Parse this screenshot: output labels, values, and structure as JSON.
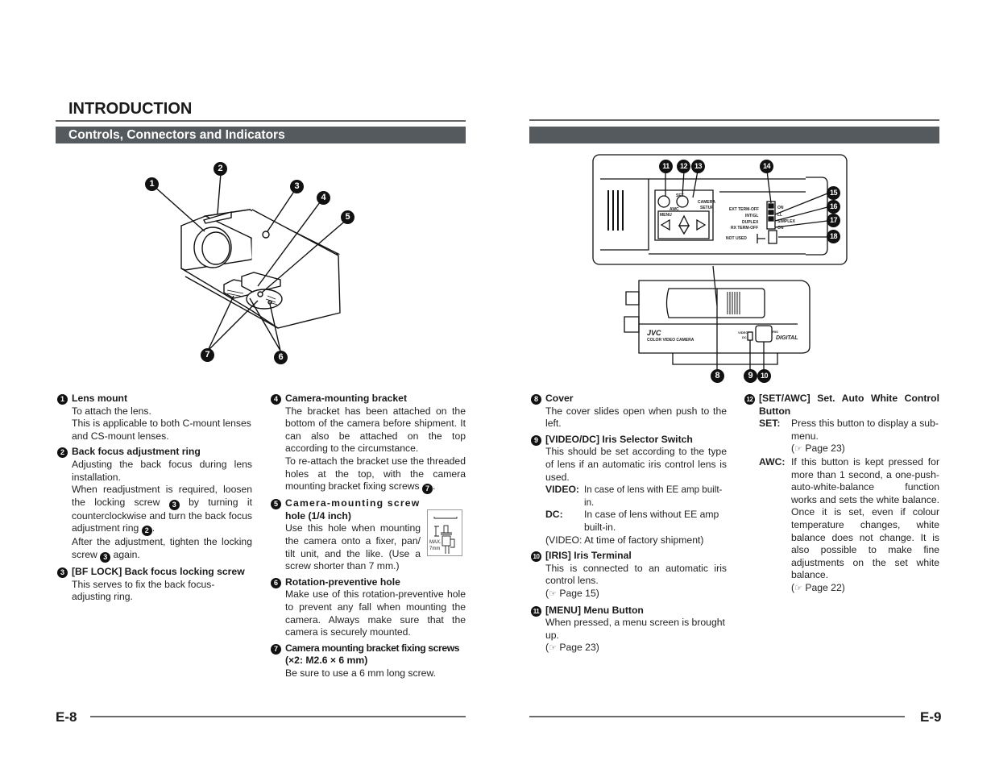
{
  "left_page": {
    "title": "INTRODUCTION",
    "section_title": "Controls, Connectors and Indicators",
    "page_number": "E-8",
    "figure_callouts": [
      "1",
      "2",
      "3",
      "4",
      "5",
      "6",
      "7"
    ],
    "items": [
      {
        "num": "1",
        "heading": "Lens mount",
        "lines": [
          "To attach the lens.",
          "This is applicable to both C-mount lenses and CS-mount lenses."
        ]
      },
      {
        "num": "2",
        "heading": "Back focus adjustment ring",
        "p1": "Adjusting the back focus during lens installation.",
        "p2a": "When readjustment is required, loosen the locking screw",
        "p2_ref1": "3",
        "p2b": "by turning it counterclockwise and turn the back focus adjustment ring",
        "p2_ref2": "2",
        "p2c": ".",
        "p3a": "After the adjustment, tighten the locking screw",
        "p3_ref": "3",
        "p3b": "again."
      },
      {
        "num": "3",
        "heading": "[BF LOCK] Back focus locking screw",
        "text": "This serves to fix the back focus-adjusting ring."
      },
      {
        "num": "4",
        "heading": "Camera-mounting bracket",
        "p1": "The bracket has been attached on the bottom of the camera before shipment. It can also be attached on the top according to the circumstance.",
        "p2": "To re-attach the bracket use the threaded holes at the top, with the camera mounting bracket fixing screws",
        "p2_ref": "7",
        "p2_end": "."
      },
      {
        "num": "5",
        "heading_a": "Camera-mounting screw",
        "heading_b": "hole (1/4 inch)",
        "text": "Use this hole when mounting the camera onto a fixer, pan/ tilt unit, and the like. (Use a screw shorter than 7 mm.)",
        "inset_label_1": "MAX.",
        "inset_label_2": "7mm"
      },
      {
        "num": "6",
        "heading": "Rotation-preventive hole",
        "text": "Make use of this rotation-preventive hole to prevent any fall when mounting the camera.  Always make sure that the camera is securely mounted."
      },
      {
        "num": "7",
        "heading_a": "Camera mounting bracket fixing screws",
        "heading_b": "(×2: M2.6 × 6 mm)",
        "text": "Be sure to use a 6 mm long screw."
      }
    ]
  },
  "right_page": {
    "section_title": "",
    "page_number": "E-9",
    "figure": {
      "top_callouts": [
        "11",
        "12",
        "13",
        "14"
      ],
      "side_callouts": [
        "15",
        "16",
        "17",
        "18"
      ],
      "bottom_callouts": [
        "8",
        "9",
        "10"
      ],
      "labels": {
        "set": "SET",
        "awc": "AWC",
        "menu": "MENU",
        "camera": "CAMERA",
        "setup": "SETUP",
        "ext_term": "EXT TERM-OFF",
        "intgl": "INT/GL",
        "duplex": "DUPLEX",
        "rx_term": "RX TERM-OFF",
        "not_used": "NOT USED",
        "on1": "ON",
        "ll": "LL",
        "simplex": "SIMPLEX",
        "on2": "ON",
        "brand": "JVC",
        "model": "COLOR  VIDEO  CAMERA",
        "digital": "DIGITAL",
        "video": "VIDEO",
        "dc": "DC",
        "iris": "IRIS"
      }
    },
    "items": [
      {
        "num": "8",
        "heading": "Cover",
        "text": "The cover slides open when push to the left."
      },
      {
        "num": "9",
        "heading": "[VIDEO/DC] Iris Selector Switch",
        "text": "This should be set according to the type of lens if an automatic iris control lens is used.",
        "defs": [
          {
            "k": "VIDEO:",
            "v": "In case of lens with EE amp built-in."
          },
          {
            "k": "DC:",
            "v": "In case of lens without EE amp built-in."
          }
        ],
        "note": "(VIDEO: At time of factory shipment)"
      },
      {
        "num": "10",
        "heading": "[IRIS] Iris Terminal",
        "text": "This is connected to an automatic iris control lens.",
        "ref": "Page 15"
      },
      {
        "num": "11",
        "heading": "[MENU] Menu Button",
        "text": "When pressed, a menu screen is brought up.",
        "ref": "Page 23"
      },
      {
        "num": "12",
        "heading": "[SET/AWC] Set. Auto White Control Button",
        "defs": [
          {
            "k": "SET:",
            "v": "Press this button to display a sub-menu.",
            "ref": "Page 23"
          },
          {
            "k": "AWC:",
            "v": "If this button is kept pressed for more than 1 second, a one-push-auto-white-balance function works and sets the white balance.  Once it is set, even if colour temperature changes, white balance does not change. It is also possible to make fine adjustments on the set white balance.",
            "ref": "Page 22"
          }
        ]
      }
    ]
  },
  "ref_icon": "☞"
}
